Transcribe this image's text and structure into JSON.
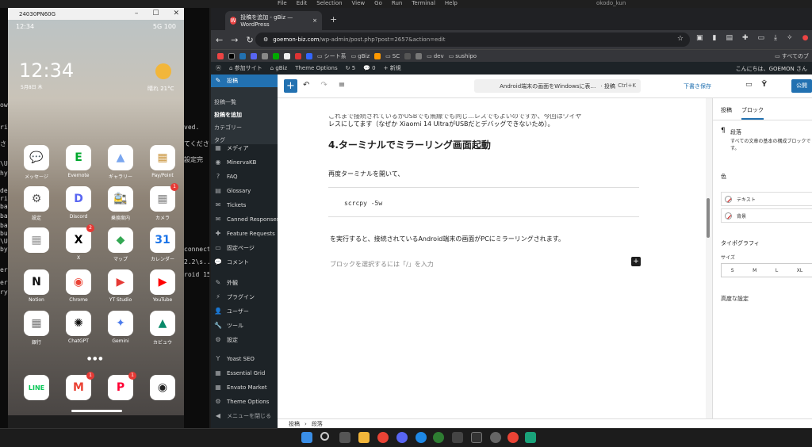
{
  "vscode": {
    "menu": [
      "File",
      "Edit",
      "Selection",
      "View",
      "Go",
      "Run",
      "Terminal",
      "Help"
    ],
    "title": "okodo_kun"
  },
  "terminal": {
    "lines": [
      "ows",
      "rig",
      "さ",
      "\\U",
      "hy",
      "de",
      "ri.",
      "ba",
      "ba",
      "ba",
      "bu",
      "\\U",
      "by",
      "er",
      "er",
      "ry"
    ],
    "behind": [
      "ved.",
      "てくださ",
      "設定完",
      "connect.",
      "2.2\\s..",
      "roid 15"
    ]
  },
  "phone": {
    "window_title": "24030PN60G",
    "status_time": "12:34",
    "status_right": "5G 100",
    "clock": "12:34",
    "date": "5月8日 木",
    "weather": "晴れ 21°C",
    "apps": [
      {
        "label": "メッセージ",
        "glyph": "💬",
        "color": "#1a73e8",
        "badge": ""
      },
      {
        "label": "Evernote",
        "glyph": "E",
        "color": "#00a82d",
        "badge": ""
      },
      {
        "label": "ギャラリー",
        "glyph": "▲",
        "color": "#7aa6ef",
        "badge": ""
      },
      {
        "label": "Pay/Point",
        "glyph": "▦",
        "color": "#c94",
        "badge": ""
      },
      {
        "label": "設定",
        "glyph": "⚙",
        "color": "#555",
        "badge": ""
      },
      {
        "label": "Discord",
        "glyph": "D",
        "color": "#5865f2",
        "badge": ""
      },
      {
        "label": "乗換案内",
        "glyph": "🚉",
        "color": "#e8502f",
        "badge": ""
      },
      {
        "label": "カメラ",
        "glyph": "▦",
        "color": "#888",
        "badge": "1"
      },
      {
        "label": "",
        "glyph": "▦",
        "color": "#999",
        "badge": ""
      },
      {
        "label": "X",
        "glyph": "X",
        "color": "#000",
        "badge": "2"
      },
      {
        "label": "マップ",
        "glyph": "◆",
        "color": "#34a853",
        "badge": ""
      },
      {
        "label": "カレンダー",
        "glyph": "31",
        "color": "#1a73e8",
        "badge": ""
      },
      {
        "label": "Notion",
        "glyph": "N",
        "color": "#111",
        "badge": ""
      },
      {
        "label": "Chrome",
        "glyph": "◉",
        "color": "#ea4335",
        "badge": ""
      },
      {
        "label": "YT Studio",
        "glyph": "▶",
        "color": "#e53935",
        "badge": ""
      },
      {
        "label": "YouTube",
        "glyph": "▶",
        "color": "#ff0000",
        "badge": ""
      },
      {
        "label": "銀行",
        "glyph": "▦",
        "color": "#777",
        "badge": ""
      },
      {
        "label": "ChatGPT",
        "glyph": "✺",
        "color": "#111",
        "badge": ""
      },
      {
        "label": "Gemini",
        "glyph": "✦",
        "color": "#4b7bec",
        "badge": ""
      },
      {
        "label": "カビュウ",
        "glyph": "▲",
        "color": "#0a8a6a",
        "badge": ""
      }
    ],
    "dock": [
      {
        "label": "LINE",
        "glyph": "LINE",
        "color": "#06c755",
        "badge": ""
      },
      {
        "label": "Gmail",
        "glyph": "M",
        "color": "#ea4335",
        "badge": "1"
      },
      {
        "label": "PayPay",
        "glyph": "P",
        "color": "#ff0033",
        "badge": "1"
      },
      {
        "label": "Camera",
        "glyph": "◉",
        "color": "#222",
        "badge": ""
      }
    ]
  },
  "browser": {
    "tab_title": "投稿を追加 - gBiz — WordPress",
    "tab_close": "×",
    "new_tab": "+",
    "url_host": "goemon-biz.com",
    "url_path": "/wp-admin/post.php?post=2657&action=edit",
    "bookmarks": [
      "シート系",
      "gBiz",
      "SC",
      "dev",
      "sushipo"
    ],
    "bookmarks_all": "すべてのブ"
  },
  "adminbar": {
    "site": "参加サイト",
    "site2": "gBiz",
    "theme_options": "Theme Options",
    "updates": "5",
    "comments": "0",
    "new": "新規",
    "greeting": "こんにちは、GOEMON さん"
  },
  "sidebar": {
    "current": "投稿",
    "sub": [
      "投稿一覧",
      "投稿を追加",
      "カテゴリー",
      "タグ"
    ],
    "items": [
      "メディア",
      "MinervaKB",
      "FAQ",
      "Glossary",
      "Tickets",
      "Canned Responses",
      "Feature Requests",
      "固定ページ",
      "コメント",
      "外観",
      "プラグイン",
      "ユーザー",
      "ツール",
      "設定",
      "Yoast SEO",
      "Essential Grid",
      "Envato Market",
      "Theme Options",
      "メニューを閉じる"
    ]
  },
  "editor": {
    "doc_title": "Android端末の画面をWindowsに表…",
    "doc_type": "· 投稿",
    "shortcut": "Ctrl+K",
    "draft": "下書き保存",
    "publish": "公開",
    "p_top": "これまで接続されているがUSBでも無線でも同じ...レスでもよいのですが、今回はワイヤ",
    "p_top2": "レスにしてます（なぜか Xiaomi 14 UltraがUSBだとデバッグできないため）。",
    "heading": "4.ターミナルでミラーリング画面起動",
    "p_again": "再度ターミナルを開いて、",
    "code": "scrcpy -5w",
    "p_result": "を実行すると、接続されているAndroid端末の画面がPCにミラーリングされます。",
    "placeholder": "ブロックを選択するには「/」を入力",
    "breadcrumb": [
      "投稿",
      "›",
      "段落"
    ]
  },
  "settings": {
    "tab_post": "投稿",
    "tab_block": "ブロック",
    "block_name": "段落",
    "block_desc": "すべての文章の基本の構成ブロックです。",
    "color": "色",
    "text": "テキスト",
    "background": "背景",
    "typography": "タイポグラフィ",
    "size": "サイズ",
    "sizes": [
      "S",
      "M",
      "L",
      "XL"
    ],
    "advanced": "高度な設定"
  },
  "colors": {
    "wp_blue": "#2271b1",
    "admin_dark": "#1d2327"
  }
}
